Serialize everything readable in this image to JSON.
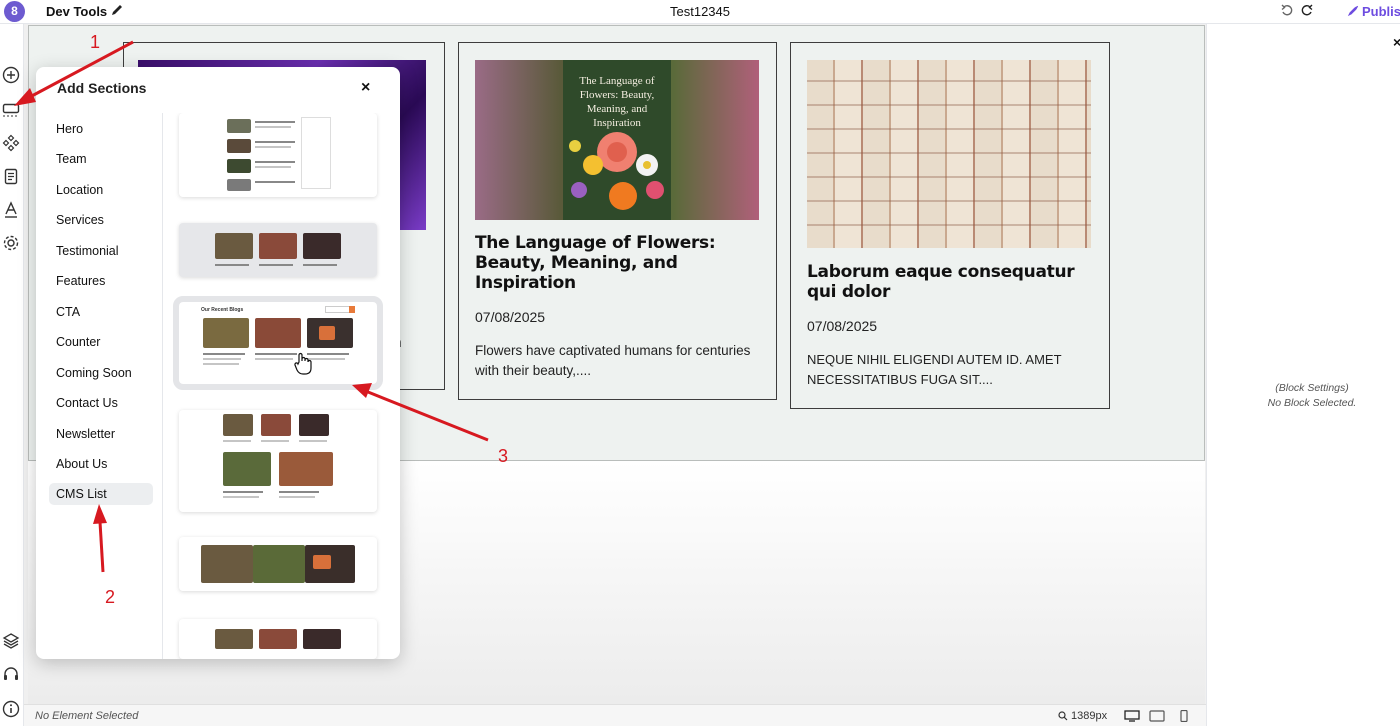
{
  "topbar": {
    "logo_text": "8",
    "app_title": "Dev Tools",
    "page_name": "Test12345",
    "publish_label": "Publish"
  },
  "modal": {
    "title": "Add Sections",
    "close_label": "×",
    "sections": [
      "Hero",
      "Team",
      "Location",
      "Services",
      "Testimonial",
      "Features",
      "CTA",
      "Counter",
      "Coming Soon",
      "Contact Us",
      "Newsletter",
      "About Us",
      "CMS List"
    ],
    "active_section": "CMS List",
    "thumb_heading": "Our Recent Blogs"
  },
  "cards": [
    {
      "cover_text": "",
      "title": "",
      "date": "",
      "excerpt_tail": "n"
    },
    {
      "cover_text": "The Language of Flowers: Beauty, Meaning, and Inspiration",
      "title": "The Language of Flowers: Beauty, Meaning, and Inspiration",
      "date": "07/08/2025",
      "excerpt": "Flowers have captivated humans for centuries with their beauty,...."
    },
    {
      "title": "Laborum eaque consequatur qui dolor",
      "date": "07/08/2025",
      "excerpt": "NEQUE NIHIL ELIGENDI AUTEM ID. AMET NECESSITATIBUS FUGA SIT...."
    }
  ],
  "right_panel": {
    "close_label": "×",
    "line1": "(Block Settings)",
    "line2": "No Block Selected."
  },
  "statusbar": {
    "status": "No Element Selected",
    "zoom": "1389px"
  },
  "annotations": [
    "1",
    "2",
    "3"
  ],
  "colors": {
    "brand": "#6d5bd0",
    "publish": "#6d4ce0",
    "annotation": "#d71920"
  }
}
